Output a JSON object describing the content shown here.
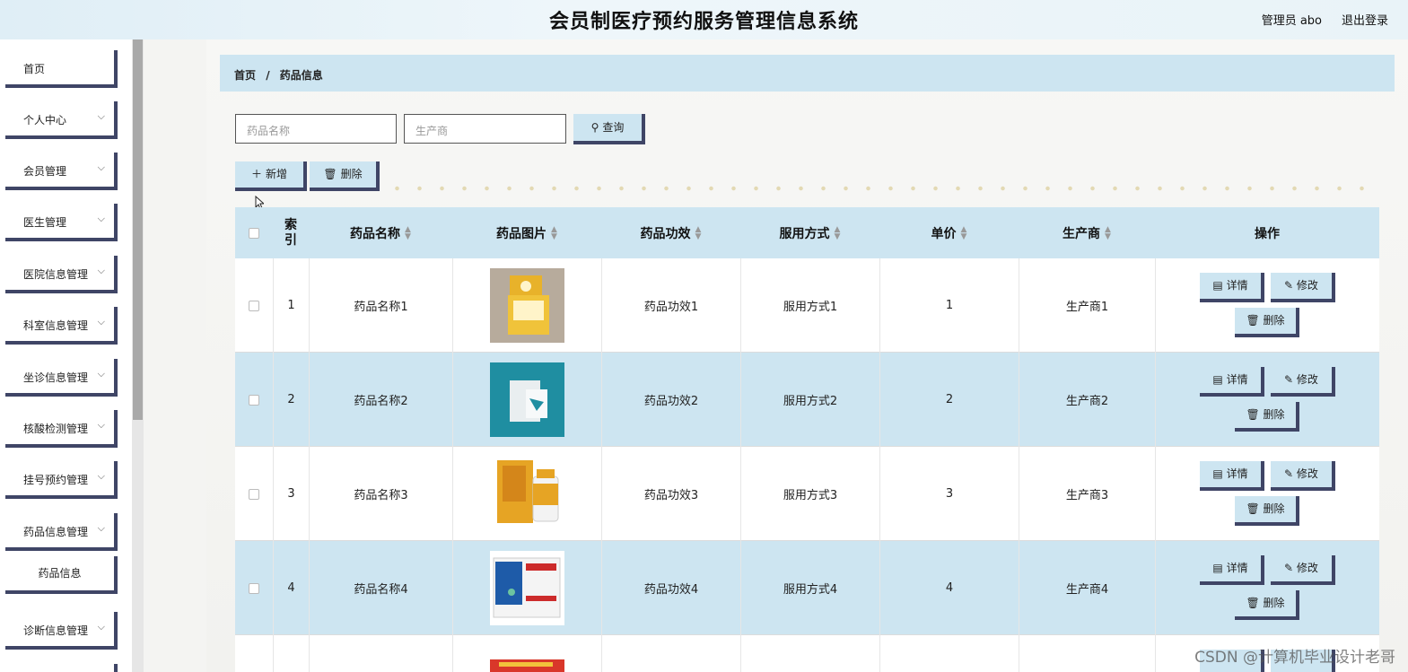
{
  "header": {
    "title": "会员制医疗预约服务管理信息系统",
    "user": "管理员 abo",
    "logout": "退出登录"
  },
  "sidebar": {
    "items": [
      {
        "label": "首页",
        "chevron": false
      },
      {
        "label": "个人中心",
        "chevron": true
      },
      {
        "label": "会员管理",
        "chevron": true
      },
      {
        "label": "医生管理",
        "chevron": true
      },
      {
        "label": "医院信息管理",
        "chevron": true
      },
      {
        "label": "科室信息管理",
        "chevron": true
      },
      {
        "label": "坐诊信息管理",
        "chevron": true
      },
      {
        "label": "核酸检测管理",
        "chevron": true
      },
      {
        "label": "挂号预约管理",
        "chevron": true
      },
      {
        "label": "药品信息管理",
        "chevron": true
      },
      {
        "label": "诊断信息管理",
        "chevron": true
      }
    ],
    "sub_item": "药品信息"
  },
  "breadcrumb": {
    "home": "首页",
    "sep": "/",
    "current": "药品信息"
  },
  "search": {
    "name_placeholder": "药品名称",
    "maker_placeholder": "生产商",
    "query": "查询"
  },
  "toolbar": {
    "add": "新增",
    "delete": "删除"
  },
  "table": {
    "headers": [
      "索引",
      "药品名称",
      "药品图片",
      "药品功效",
      "服用方式",
      "单价",
      "生产商",
      "操作"
    ],
    "rows": [
      {
        "index": "1",
        "name": "药品名称1",
        "effect": "药品功效1",
        "usage": "服用方式1",
        "price": "1",
        "maker": "生产商1"
      },
      {
        "index": "2",
        "name": "药品名称2",
        "effect": "药品功效2",
        "usage": "服用方式2",
        "price": "2",
        "maker": "生产商2"
      },
      {
        "index": "3",
        "name": "药品名称3",
        "effect": "药品功效3",
        "usage": "服用方式3",
        "price": "3",
        "maker": "生产商3"
      },
      {
        "index": "4",
        "name": "药品名称4",
        "effect": "药品功效4",
        "usage": "服用方式4",
        "price": "4",
        "maker": "生产商4"
      }
    ],
    "actions": {
      "detail": "详情",
      "edit": "修改",
      "delete": "删除"
    }
  },
  "watermark": "CSDN @计算机毕业设计老哥",
  "colors": {
    "accent": "#cde5f1",
    "border": "#3f4566"
  }
}
